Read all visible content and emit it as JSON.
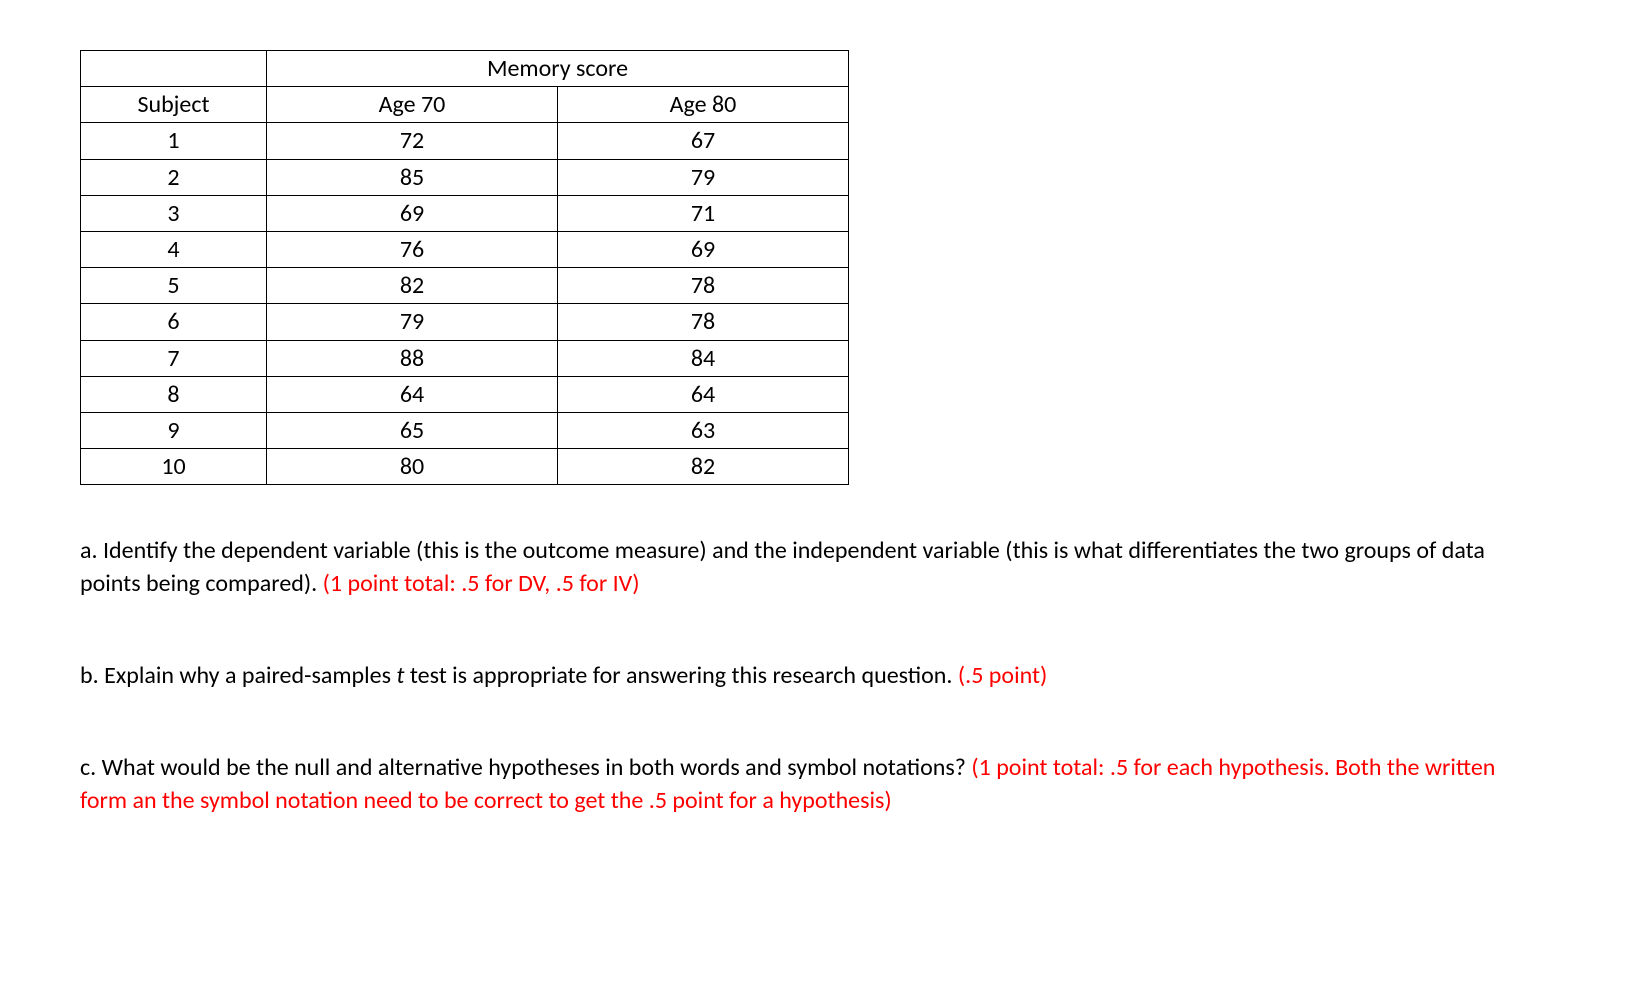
{
  "table": {
    "header_merged": "Memory score",
    "col_subject": "Subject",
    "col_age70": "Age 70",
    "col_age80": "Age 80",
    "rows": [
      {
        "subject": "1",
        "age70": "72",
        "age80": "67"
      },
      {
        "subject": "2",
        "age70": "85",
        "age80": "79"
      },
      {
        "subject": "3",
        "age70": "69",
        "age80": "71"
      },
      {
        "subject": "4",
        "age70": "76",
        "age80": "69"
      },
      {
        "subject": "5",
        "age70": "82",
        "age80": "78"
      },
      {
        "subject": "6",
        "age70": "79",
        "age80": "78"
      },
      {
        "subject": "7",
        "age70": "88",
        "age80": "84"
      },
      {
        "subject": "8",
        "age70": "64",
        "age80": "64"
      },
      {
        "subject": "9",
        "age70": "65",
        "age80": "63"
      },
      {
        "subject": "10",
        "age70": "80",
        "age80": "82"
      }
    ]
  },
  "questions": {
    "a": {
      "text": "a. Identify the dependent variable (this is the outcome measure) and the independent variable (this is what differentiates the two groups of data points being compared). ",
      "points": "(1 point total: .5 for DV, .5 for IV)"
    },
    "b": {
      "prefix": "b. Explain why a paired-samples ",
      "italic": "t",
      "suffix": " test is appropriate for answering this research question. ",
      "points": "(.5 point)"
    },
    "c": {
      "text": "c. What would be the null and alternative hypotheses in both words and symbol notations? ",
      "points": "(1 point total: .5 for each hypothesis. Both the written form an the symbol notation need to be correct to get the .5 point for a hypothesis)"
    }
  }
}
